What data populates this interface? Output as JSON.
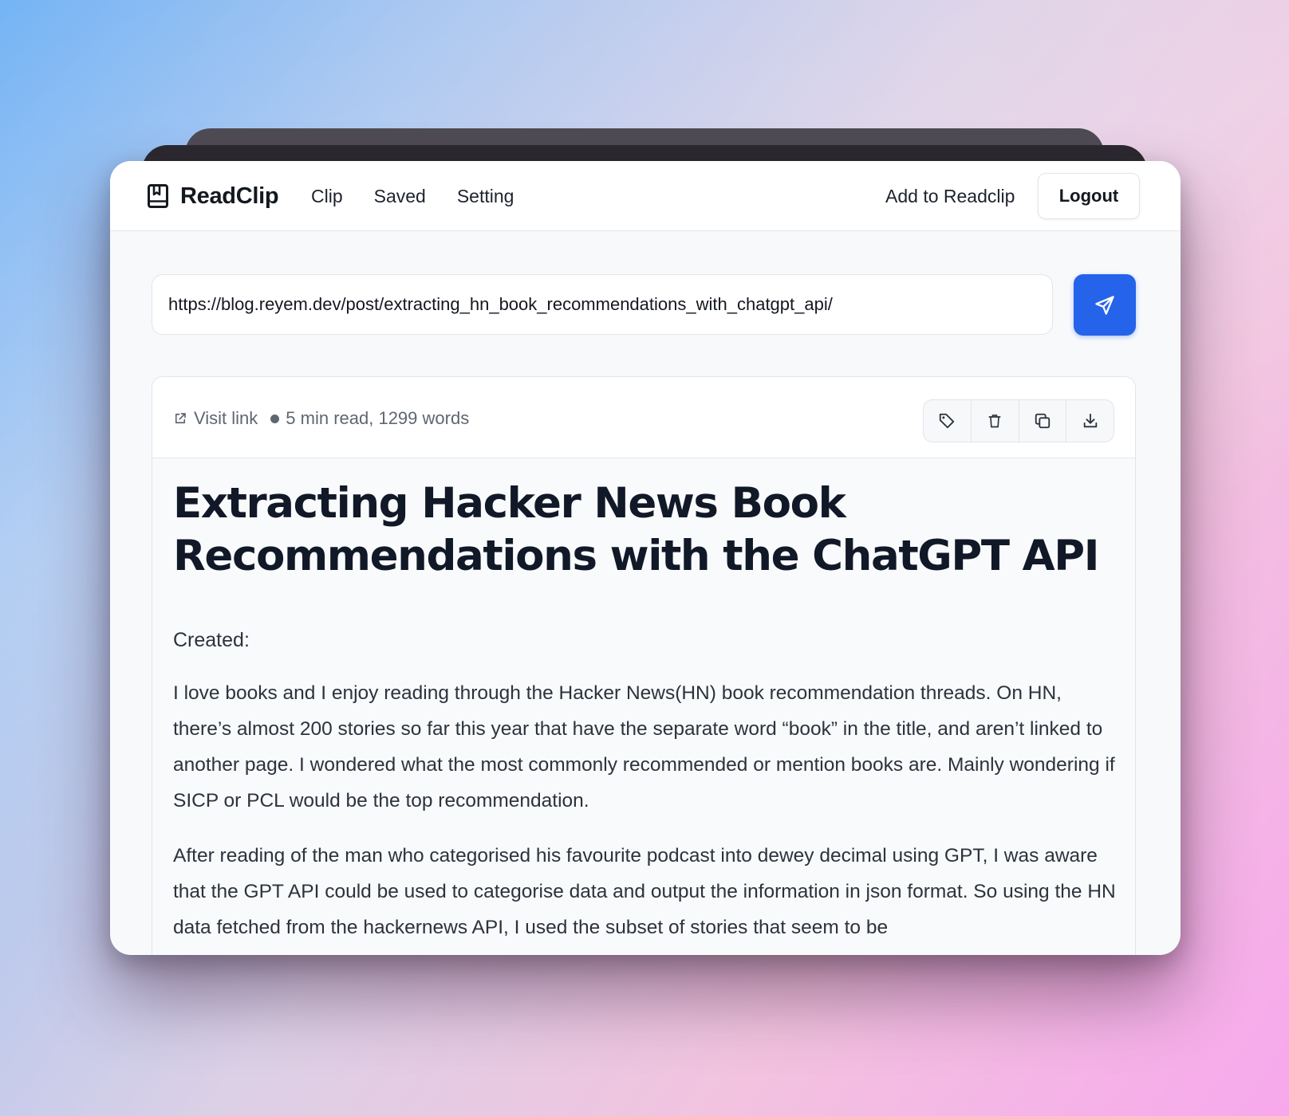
{
  "app": {
    "name": "ReadClip"
  },
  "nav": {
    "links": [
      "Clip",
      "Saved",
      "Setting"
    ],
    "add_label": "Add to Readclip",
    "logout_label": "Logout"
  },
  "url_input": {
    "value": "https://blog.reyem.dev/post/extracting_hn_book_recommendations_with_chatgpt_api/"
  },
  "card": {
    "visit_label": "Visit link",
    "meta_text": "5 min read, 1299 words",
    "actions": [
      "tag-icon",
      "trash-icon",
      "copy-icon",
      "download-icon"
    ]
  },
  "article": {
    "title": "Extracting Hacker News Book Recommendations with the ChatGPT API",
    "created_label": "Created:",
    "paragraphs": [
      "I love books and I enjoy reading through the Hacker News(HN) book recommendation threads. On HN, there’s almost 200 stories so far this year that have the separate word “book” in the title, and aren’t linked to another page. I wondered what the most commonly recommended or mention books are. Mainly wondering if SICP or PCL would be the top recommendation.",
      "After reading of the man who categorised his favourite podcast into dewey decimal using GPT, I was aware that the GPT API could be used to categorise data and output the information in json format. So using the HN data fetched from the hackernews API, I used the subset of stories that seem to be"
    ]
  },
  "colors": {
    "accent": "#2563eb",
    "text": "#14181f",
    "muted": "#5f6672"
  }
}
